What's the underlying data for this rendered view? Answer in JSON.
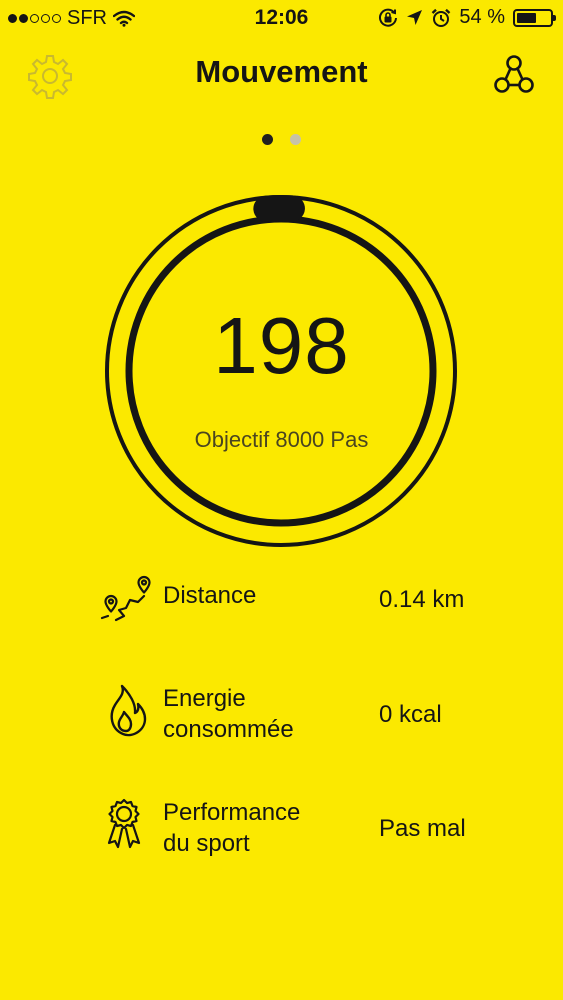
{
  "status_bar": {
    "carrier": "SFR",
    "time": "12:06",
    "battery_percent": "54 %",
    "battery_level": 0.54
  },
  "header": {
    "title": "Mouvement",
    "settings_icon": "gear-icon",
    "share_icon": "share-icon"
  },
  "pager": {
    "pages": 2,
    "active": 0
  },
  "progress": {
    "steps": "198",
    "goal_label": "Objectif 8000 Pas",
    "fraction": 0.025
  },
  "stats": [
    {
      "icon": "route-icon",
      "label_line1": "Distance",
      "label_line2": "",
      "value": "0.14 km"
    },
    {
      "icon": "flame-icon",
      "label_line1": "Energie",
      "label_line2": "consommée",
      "value": "0 kcal"
    },
    {
      "icon": "medal-icon",
      "label_line1": "Performance",
      "label_line2": "du sport",
      "value": "Pas mal"
    }
  ],
  "colors": {
    "background": "#FBE900",
    "foreground": "#151515"
  }
}
